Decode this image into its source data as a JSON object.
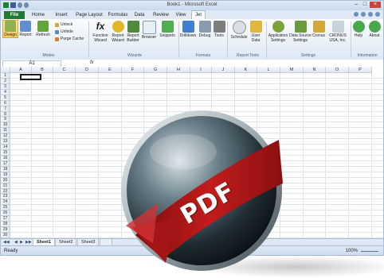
{
  "window": {
    "title": "Book1 - Microsoft Excel"
  },
  "tabs": [
    {
      "label": "File"
    },
    {
      "label": "Home"
    },
    {
      "label": "Insert"
    },
    {
      "label": "Page Layout"
    },
    {
      "label": "Formulas"
    },
    {
      "label": "Data"
    },
    {
      "label": "Review"
    },
    {
      "label": "View"
    },
    {
      "label": "Jet"
    }
  ],
  "ribbon": {
    "modes": {
      "label": "Modes",
      "design": "Design",
      "report": "Report",
      "refresh": "Refresh",
      "unlock": "Unlock",
      "unhide": "Unhide",
      "purge": "Purge Cache"
    },
    "wizards": {
      "label": "Wizards",
      "function_wizard": [
        "Function",
        "Wizard"
      ],
      "report_wizard": [
        "Report",
        "Wizard"
      ],
      "report_builder": [
        "Report",
        "Builder"
      ],
      "browser": "Browser",
      "snippets": "Snippets"
    },
    "formula": {
      "label": "Formula",
      "drilldown": "Drilldown",
      "debug": "Debug",
      "tools": "Tools"
    },
    "report_tools": {
      "label": "Report Tools",
      "schedule": "Schedule",
      "user_data": [
        "User",
        "Data"
      ]
    },
    "settings": {
      "label": "Settings",
      "app_settings": [
        "Application",
        "Settings"
      ],
      "ds_settings": [
        "Data Source",
        "Settings"
      ],
      "cronus": "Cronus",
      "cronus_usa": [
        "CRONUS",
        "USA, Inc."
      ]
    },
    "information": {
      "label": "Information",
      "help": "Help",
      "about": "About"
    }
  },
  "formula_bar": {
    "name_box": "A1",
    "fx": "fx"
  },
  "grid": {
    "columns": [
      "A",
      "B",
      "C",
      "D",
      "E",
      "F",
      "G",
      "H",
      "I",
      "J",
      "K",
      "L",
      "M",
      "N",
      "O",
      "P"
    ],
    "rows": [
      "1",
      "2",
      "3",
      "4",
      "5",
      "6",
      "7",
      "8",
      "9",
      "10",
      "11",
      "12",
      "13",
      "14",
      "15",
      "16",
      "17",
      "18",
      "19",
      "20",
      "21",
      "22",
      "23",
      "24",
      "25",
      "26",
      "27",
      "28",
      "29",
      "30"
    ]
  },
  "sheets": [
    "Sheet1",
    "Sheet2",
    "Sheet3"
  ],
  "status": {
    "ready": "Ready",
    "zoom": "100%"
  },
  "overlay": {
    "pdf_label": "PDF"
  },
  "colors": {
    "file_tab": "#1d7b32",
    "active_button": "#f8c85c",
    "pdf_red": "#b01818"
  }
}
